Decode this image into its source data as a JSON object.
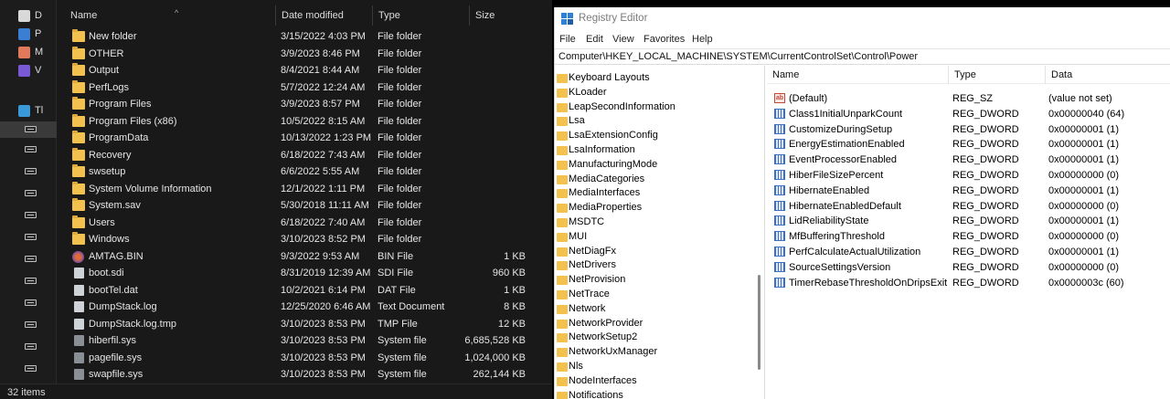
{
  "explorer": {
    "nav": [
      {
        "label": "D",
        "icon": "desktop-icon",
        "color": "#d9d9d9"
      },
      {
        "label": "P",
        "icon": "pictures-icon",
        "color": "#3a7fd4"
      },
      {
        "label": "M",
        "icon": "music-icon",
        "color": "#e07a5a"
      },
      {
        "label": "V",
        "icon": "videos-icon",
        "color": "#7a5ad4"
      },
      {
        "label": "Tl",
        "icon": "this-pc-icon",
        "color": "#3a9ad9"
      }
    ],
    "columns": {
      "name": "Name",
      "date": "Date modified",
      "type": "Type",
      "size": "Size"
    },
    "files": [
      {
        "name": "New folder",
        "date": "3/15/2022 4:03 PM",
        "type": "File folder",
        "size": "",
        "icon": "folder-icon"
      },
      {
        "name": "OTHER",
        "date": "3/9/2023 8:46 PM",
        "type": "File folder",
        "size": "",
        "icon": "folder-icon"
      },
      {
        "name": "Output",
        "date": "8/4/2021 8:44 AM",
        "type": "File folder",
        "size": "",
        "icon": "folder-icon"
      },
      {
        "name": "PerfLogs",
        "date": "5/7/2022 12:24 AM",
        "type": "File folder",
        "size": "",
        "icon": "folder-icon"
      },
      {
        "name": "Program Files",
        "date": "3/9/2023 8:57 PM",
        "type": "File folder",
        "size": "",
        "icon": "folder-icon"
      },
      {
        "name": "Program Files (x86)",
        "date": "10/5/2022 8:15 AM",
        "type": "File folder",
        "size": "",
        "icon": "folder-icon"
      },
      {
        "name": "ProgramData",
        "date": "10/13/2022 1:23 PM",
        "type": "File folder",
        "size": "",
        "icon": "folder-icon"
      },
      {
        "name": "Recovery",
        "date": "6/18/2022 7:43 AM",
        "type": "File folder",
        "size": "",
        "icon": "folder-icon"
      },
      {
        "name": "swsetup",
        "date": "6/6/2022 5:55 AM",
        "type": "File folder",
        "size": "",
        "icon": "folder-icon"
      },
      {
        "name": "System Volume Information",
        "date": "12/1/2022 1:11 PM",
        "type": "File folder",
        "size": "",
        "icon": "folder-icon"
      },
      {
        "name": "System.sav",
        "date": "5/30/2018 11:11 AM",
        "type": "File folder",
        "size": "",
        "icon": "folder-icon"
      },
      {
        "name": "Users",
        "date": "6/18/2022 7:40 AM",
        "type": "File folder",
        "size": "",
        "icon": "folder-icon"
      },
      {
        "name": "Windows",
        "date": "3/10/2023 8:52 PM",
        "type": "File folder",
        "size": "",
        "icon": "folder-icon"
      },
      {
        "name": "AMTAG.BIN",
        "date": "9/3/2022 9:53 AM",
        "type": "BIN File",
        "size": "1 KB",
        "icon": "bin-file-icon"
      },
      {
        "name": "boot.sdi",
        "date": "8/31/2019 12:39 AM",
        "type": "SDI File",
        "size": "960 KB",
        "icon": "file-icon"
      },
      {
        "name": "bootTel.dat",
        "date": "10/2/2021 6:14 PM",
        "type": "DAT File",
        "size": "1 KB",
        "icon": "file-icon"
      },
      {
        "name": "DumpStack.log",
        "date": "12/25/2020 6:46 AM",
        "type": "Text Document",
        "size": "8 KB",
        "icon": "file-icon"
      },
      {
        "name": "DumpStack.log.tmp",
        "date": "3/10/2023 8:53 PM",
        "type": "TMP File",
        "size": "12 KB",
        "icon": "file-icon"
      },
      {
        "name": "hiberfil.sys",
        "date": "3/10/2023 8:53 PM",
        "type": "System file",
        "size": "6,685,528 KB",
        "icon": "system-file-icon"
      },
      {
        "name": "pagefile.sys",
        "date": "3/10/2023 8:53 PM",
        "type": "System file",
        "size": "1,024,000 KB",
        "icon": "system-file-icon"
      },
      {
        "name": "swapfile.sys",
        "date": "3/10/2023 8:53 PM",
        "type": "System file",
        "size": "262,144 KB",
        "icon": "system-file-icon"
      }
    ],
    "status": "32 items"
  },
  "regedit": {
    "title": "Registry Editor",
    "menu": [
      "File",
      "Edit",
      "View",
      "Favorites",
      "Help"
    ],
    "address": "Computer\\HKEY_LOCAL_MACHINE\\SYSTEM\\CurrentControlSet\\Control\\Power",
    "tree": [
      "Keyboard Layouts",
      "KLoader",
      "LeapSecondInformation",
      "Lsa",
      "LsaExtensionConfig",
      "LsaInformation",
      "ManufacturingMode",
      "MediaCategories",
      "MediaInterfaces",
      "MediaProperties",
      "MSDTC",
      "MUI",
      "NetDiagFx",
      "NetDrivers",
      "NetProvision",
      "NetTrace",
      "Network",
      "NetworkProvider",
      "NetworkSetup2",
      "NetworkUxManager",
      "Nls",
      "NodeInterfaces",
      "Notifications"
    ],
    "columns": {
      "name": "Name",
      "type": "Type",
      "data": "Data"
    },
    "values": [
      {
        "name": "(Default)",
        "type": "REG_SZ",
        "data": "(value not set)",
        "icon": "string-value-icon"
      },
      {
        "name": "Class1InitialUnparkCount",
        "type": "REG_DWORD",
        "data": "0x00000040 (64)",
        "icon": "binary-value-icon"
      },
      {
        "name": "CustomizeDuringSetup",
        "type": "REG_DWORD",
        "data": "0x00000001 (1)",
        "icon": "binary-value-icon"
      },
      {
        "name": "EnergyEstimationEnabled",
        "type": "REG_DWORD",
        "data": "0x00000001 (1)",
        "icon": "binary-value-icon"
      },
      {
        "name": "EventProcessorEnabled",
        "type": "REG_DWORD",
        "data": "0x00000001 (1)",
        "icon": "binary-value-icon"
      },
      {
        "name": "HiberFileSizePercent",
        "type": "REG_DWORD",
        "data": "0x00000000 (0)",
        "icon": "binary-value-icon"
      },
      {
        "name": "HibernateEnabled",
        "type": "REG_DWORD",
        "data": "0x00000001 (1)",
        "icon": "binary-value-icon"
      },
      {
        "name": "HibernateEnabledDefault",
        "type": "REG_DWORD",
        "data": "0x00000000 (0)",
        "icon": "binary-value-icon"
      },
      {
        "name": "LidReliabilityState",
        "type": "REG_DWORD",
        "data": "0x00000001 (1)",
        "icon": "binary-value-icon"
      },
      {
        "name": "MfBufferingThreshold",
        "type": "REG_DWORD",
        "data": "0x00000000 (0)",
        "icon": "binary-value-icon"
      },
      {
        "name": "PerfCalculateActualUtilization",
        "type": "REG_DWORD",
        "data": "0x00000001 (1)",
        "icon": "binary-value-icon"
      },
      {
        "name": "SourceSettingsVersion",
        "type": "REG_DWORD",
        "data": "0x00000000 (0)",
        "icon": "binary-value-icon"
      },
      {
        "name": "TimerRebaseThresholdOnDripsExit",
        "type": "REG_DWORD",
        "data": "0x0000003c (60)",
        "icon": "binary-value-icon"
      }
    ]
  }
}
